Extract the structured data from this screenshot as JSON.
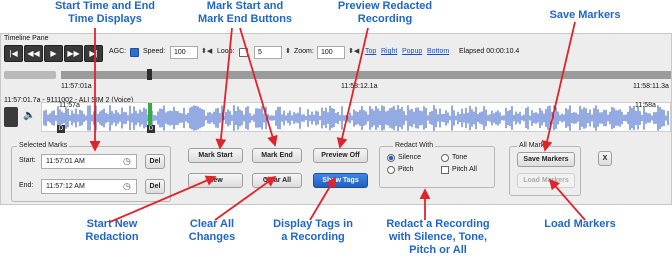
{
  "pane": {
    "title": "Timeline Pane",
    "controls": {
      "agc_label": "AGC:",
      "speed_label": "Speed:",
      "speed_value": "100",
      "loop_label": "Loop:",
      "loop_value": "5",
      "zoom_label": "Zoom:",
      "zoom_value": "100",
      "links": [
        "Top",
        "Right",
        "Popup",
        "Bottom"
      ],
      "elapsed": "Elapsed 00:00:10.4"
    },
    "timeline": {
      "time_left": "11:57:01a",
      "time_mid": "11:58:12.1a",
      "time_right": "11:58:11.3a"
    },
    "track": {
      "label": "11:57:01.7a - 9111002 - ALI SIM 2 (Voice)",
      "mark_start": "11:57a",
      "mark_end": "11:58a",
      "marker_letter": "D"
    }
  },
  "selected_marks": {
    "title": "Selected Marks",
    "start_label": "Start:",
    "start_value": "11:57:01 AM",
    "end_label": "End:",
    "end_value": "11:57:12 AM",
    "del_label": "Del"
  },
  "buttons": {
    "mark_start": "Mark Start",
    "mark_end": "Mark End",
    "preview_off": "Preview Off",
    "new": "New",
    "clear_all": "Clear All",
    "show_tags": "Show Tags"
  },
  "redact": {
    "title": "Redact With",
    "silence": "Silence",
    "tone": "Tone",
    "pitch": "Pitch",
    "pitch_all": "Pitch All"
  },
  "all_marks": {
    "title": "All Marks",
    "save": "Save Markers",
    "load": "Load Markers",
    "close": "X"
  },
  "callouts": {
    "start_end_time": "Start Time and End\nTime Displays",
    "mark_buttons": "Mark Start and\nMark End Buttons",
    "preview": "Preview Redacted\nRecording",
    "save": "Save Markers",
    "start_new": "Start New\nRedaction",
    "clear_all": "Clear All\nChanges",
    "display_tags": "Display Tags in\na Recording",
    "redact": "Redact a Recording\nwith Silence, Tone,\nPitch or All",
    "load": "Load Markers"
  },
  "colors": {
    "callout": "#1f66c9",
    "arrow": "#e0242c",
    "accent": "#2a62c4"
  }
}
